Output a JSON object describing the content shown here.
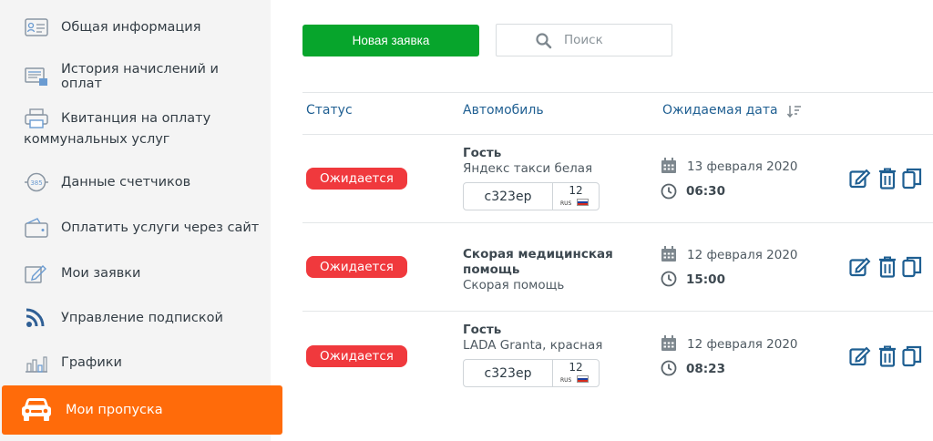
{
  "sidebar": {
    "items": [
      {
        "label": "Общая информация",
        "icon": "id-card-icon"
      },
      {
        "label": "История начислений и оплат",
        "icon": "history-icon"
      },
      {
        "label": "Квитанция на оплату",
        "label2": "коммунальных услуг",
        "icon": "printer-icon"
      },
      {
        "label": "Данные счетчиков",
        "icon": "meter-icon"
      },
      {
        "label": "Оплатить услуги через сайт",
        "icon": "wallet-icon"
      },
      {
        "label": "Мои заявки",
        "icon": "edit-icon"
      },
      {
        "label": "Управление подпиской",
        "icon": "rss-icon"
      },
      {
        "label": "Графики",
        "icon": "chart-icon"
      }
    ],
    "active": {
      "label": "Мои пропуска",
      "icon": "car-icon"
    }
  },
  "toolbar": {
    "new_button": "Новая заявка",
    "search_placeholder": "Поиск"
  },
  "table": {
    "headers": {
      "status": "Статус",
      "car": "Автомобиль",
      "date": "Ожидаемая дата"
    },
    "rows": [
      {
        "status": "Ожидается",
        "name": "Гость",
        "desc": "Яндекс такси белая",
        "plate": "с323ер",
        "region": "12",
        "country": "RUS",
        "date": "13 февраля 2020",
        "time": "06:30"
      },
      {
        "status": "Ожидается",
        "name": "Скорая медицинская",
        "name2": "помощь",
        "desc": "Скорая помощь",
        "date": "12 февраля 2020",
        "time": "15:00"
      },
      {
        "status": "Ожидается",
        "name": "Гость",
        "desc": "LADA Granta, красная",
        "plate": "с323ер",
        "region": "12",
        "country": "RUS",
        "date": "12 февраля 2020",
        "time": "08:23"
      }
    ]
  },
  "colors": {
    "accent_orange": "#ff6b0a",
    "primary_green": "#07a52c",
    "status_red": "#f0393d",
    "header_blue": "#1f5f92",
    "icon_blue": "#1f5f92"
  }
}
